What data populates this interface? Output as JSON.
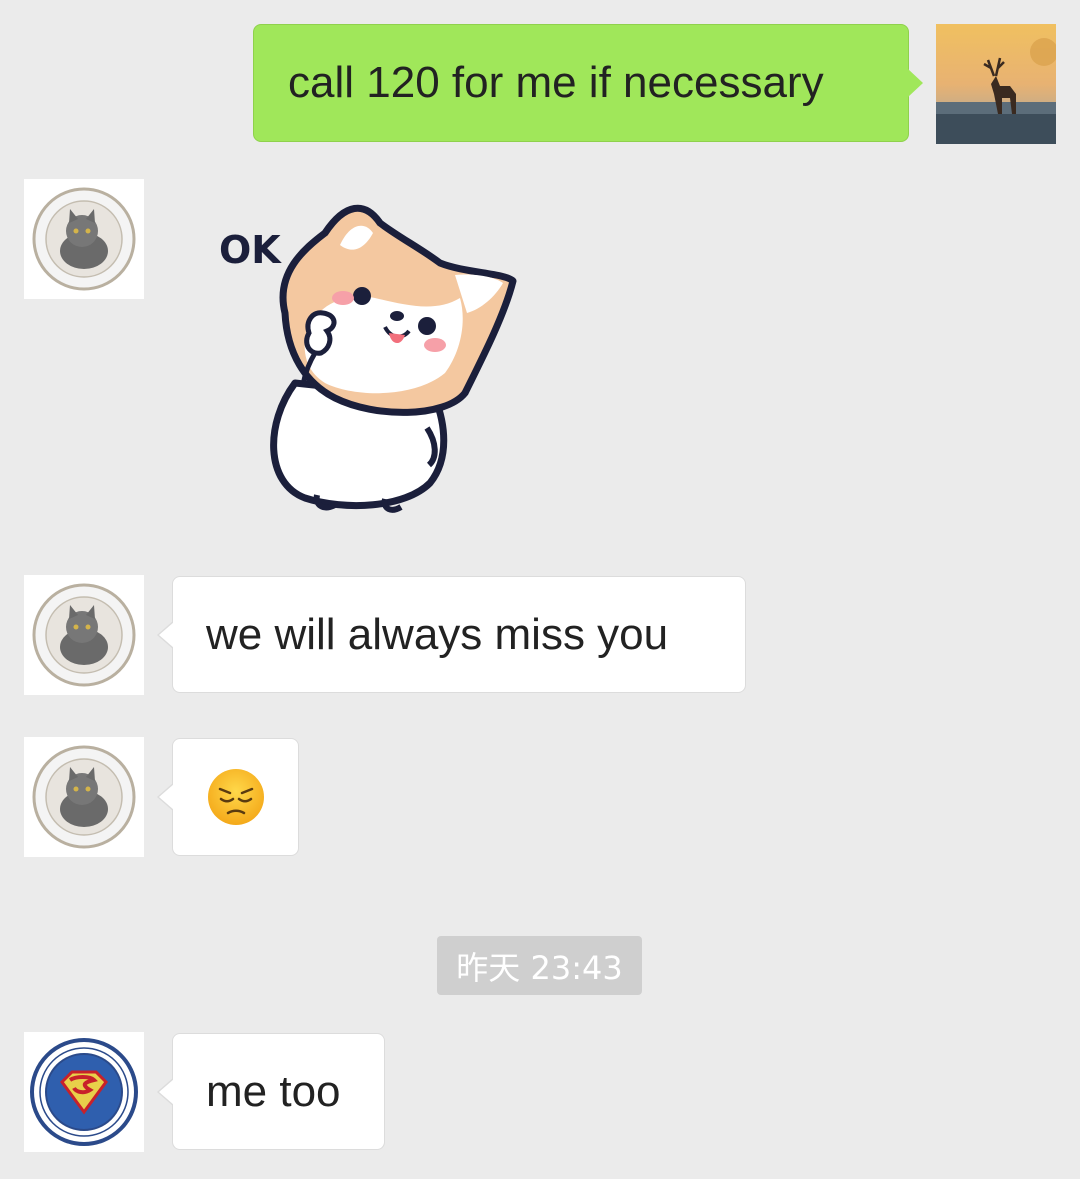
{
  "messages": [
    {
      "sender": "me",
      "type": "text",
      "text": "call 120 for me if necessary",
      "avatar": "deer-avatar-icon"
    },
    {
      "sender": "friend",
      "type": "sticker",
      "sticker": "corgi-ok-sticker",
      "sticker_text": "OK",
      "avatar": "cat-university-seal-avatar"
    },
    {
      "sender": "friend",
      "type": "text",
      "text": "we will always miss you",
      "avatar": "cat-university-seal-avatar"
    },
    {
      "sender": "friend",
      "type": "emoji",
      "emoji": "pensive-face-emoji",
      "avatar": "cat-university-seal-avatar"
    },
    {
      "sender": "friend2",
      "type": "text",
      "text": "me too",
      "avatar": "superman-university-seal-avatar"
    }
  ],
  "timestamp": "昨天 23:43",
  "colors": {
    "background": "#ebebeb",
    "my_bubble": "#a0e75a",
    "other_bubble": "#ffffff",
    "timestamp_bg": "#cfcfcf"
  }
}
